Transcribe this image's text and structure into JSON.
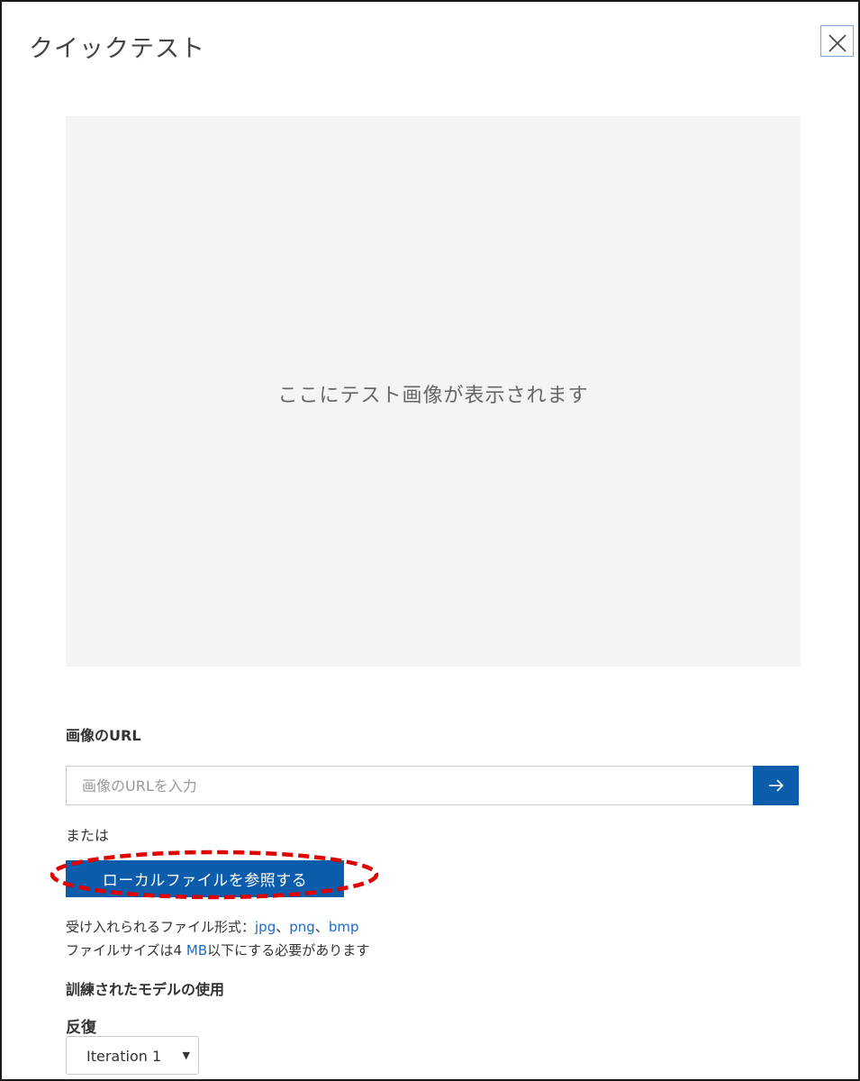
{
  "dialog": {
    "title": "クイックテスト",
    "close_icon": "close-icon"
  },
  "preview": {
    "placeholder_text": "ここにテスト画像が表示されます"
  },
  "url_section": {
    "label": "画像のURL",
    "input_placeholder": "画像のURLを入力",
    "input_value": "",
    "submit_icon": "arrow-right-icon"
  },
  "or_text": "または",
  "browse_button": {
    "label": "ローカルファイルを参照する",
    "highlight_color": "#e00000"
  },
  "file_info": {
    "formats_prefix": "受け入れられるファイル形式：",
    "formats": [
      "jpg",
      "png",
      "bmp"
    ],
    "separator": "、",
    "size_prefix": "ファイルサイズは4 ",
    "size_unit": "MB",
    "size_suffix": "以下にする必要があります"
  },
  "model_section": {
    "label": "訓練されたモデルの使用",
    "iteration_label": "反復",
    "selected_iteration": "Iteration 1",
    "dropdown_icon": "caret-down-icon"
  },
  "colors": {
    "accent": "#0b5cab",
    "link": "#1a6dc4",
    "preview_bg": "#f4f4f4",
    "close_border": "#7fa8d8"
  }
}
